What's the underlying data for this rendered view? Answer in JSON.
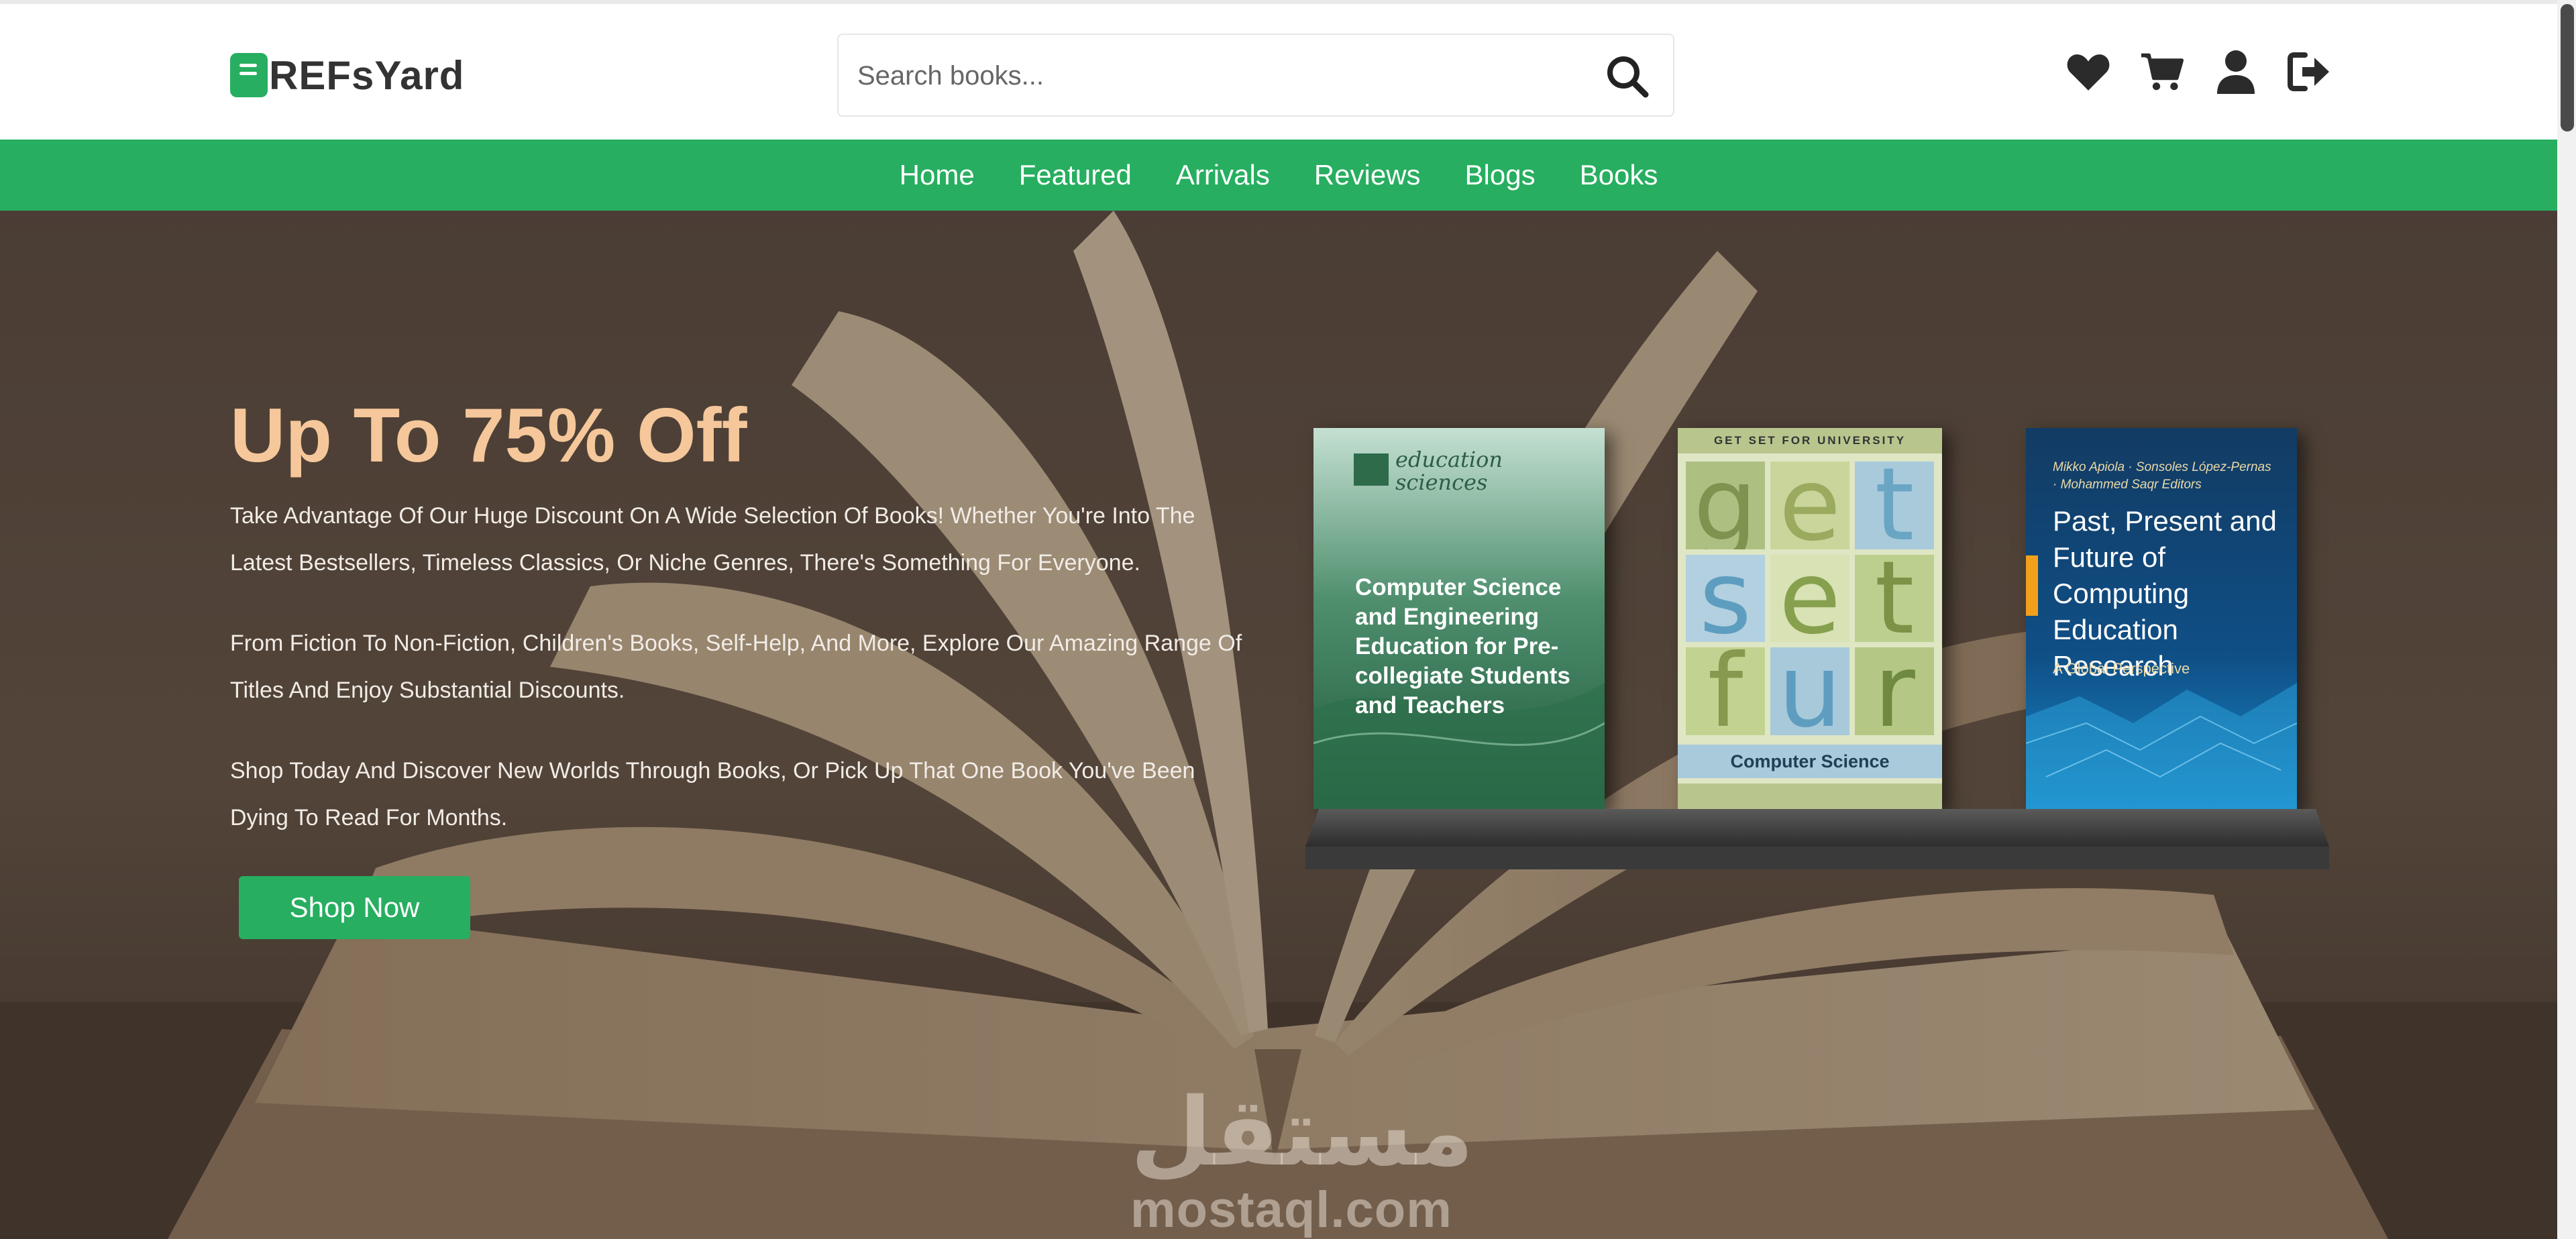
{
  "brand": {
    "name": "REFsYard",
    "accent": "#27ae60"
  },
  "search": {
    "placeholder": "Search books..."
  },
  "header_icons": [
    "heart-icon",
    "cart-icon",
    "user-icon",
    "logout-icon"
  ],
  "nav": {
    "items": [
      "Home",
      "Featured",
      "Arrivals",
      "Reviews",
      "Blogs",
      "Books"
    ]
  },
  "hero": {
    "title": "Up To 75% Off",
    "paragraphs": [
      "Take Advantage Of Our Huge Discount On A Wide Selection Of Books! Whether You're Into The Latest Bestsellers, Timeless Classics, Or Niche Genres, There's Something For Everyone.",
      "From Fiction To Non-Fiction, Children's Books, Self-Help, And More, Explore Our Amazing Range Of Titles And Enjoy Substantial Discounts.",
      "Shop Today And Discover New Worlds Through Books, Or Pick Up That One Book You've Been Dying To Read For Months."
    ],
    "cta": "Shop Now",
    "title_color": "#f5c79a"
  },
  "books": [
    {
      "publisher": "education sciences",
      "title": "Computer Science and Engineering Education for Pre-collegiate Students and Teachers"
    },
    {
      "series": "GET SET FOR UNIVERSITY",
      "letters": [
        "g",
        "e",
        "t",
        "s",
        "e",
        "t",
        "f",
        "u",
        "r"
      ],
      "title": "Computer Science"
    },
    {
      "authors": "Mikko Apiola · Sonsoles López-Pernas · Mohammed Saqr  Editors",
      "title": "Past, Present and Future of Computing Education Research",
      "subtitle": "A Global Perspective"
    }
  ],
  "watermark": {
    "arabic": "مستقل",
    "latin": "mostaql.com"
  }
}
